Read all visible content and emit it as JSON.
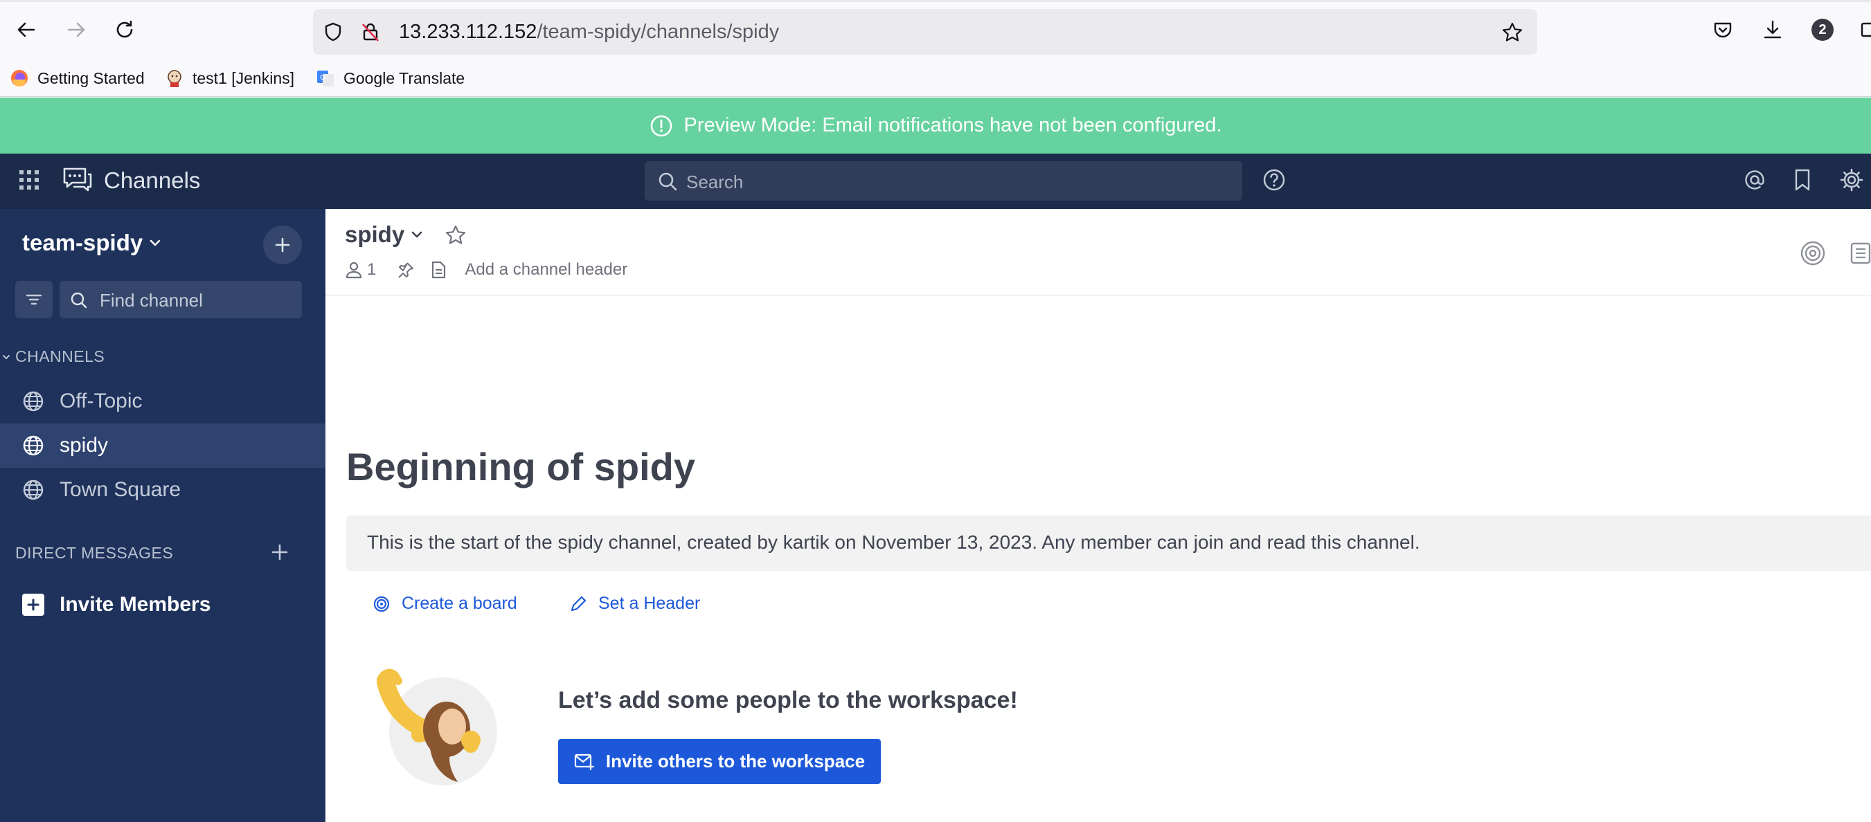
{
  "browser": {
    "url_host": "13.233.112.152",
    "url_path": "/team-spidy/channels/spidy",
    "notification_count": "2",
    "bookmarks": [
      {
        "label": "Getting Started"
      },
      {
        "label": "test1 [Jenkins]"
      },
      {
        "label": "Google Translate"
      }
    ]
  },
  "announcement": {
    "text": "Preview Mode: Email notifications have not been configured.",
    "color": "#66d29f"
  },
  "header": {
    "product_name": "Channels",
    "search_placeholder": "Search"
  },
  "sidebar": {
    "team_name": "team-spidy",
    "find_placeholder": "Find channel",
    "channels_header": "CHANNELS",
    "channels": [
      {
        "label": "Off-Topic",
        "icon": "globe-icon",
        "active": false
      },
      {
        "label": "spidy",
        "icon": "globe-icon",
        "active": true
      },
      {
        "label": "Town Square",
        "icon": "globe-icon",
        "active": false
      }
    ],
    "dm_header": "DIRECT MESSAGES",
    "invite_label": "Invite Members"
  },
  "channel": {
    "name": "spidy",
    "member_count": "1",
    "header_placeholder": "Add a channel header",
    "intro_title": "Beginning of spidy",
    "intro_text": "This is the start of the spidy channel, created by kartik on November 13, 2023. Any member can join and read this channel.",
    "create_board_label": "Create a board",
    "set_header_label": "Set a Header",
    "add_people_title": "Let’s add some people to the workspace!",
    "invite_button_label": "Invite others to the workspace"
  },
  "colors": {
    "sidebar_bg": "#1e325c",
    "global_header_bg": "#1c2b4a",
    "accent": "#1c58d9"
  }
}
